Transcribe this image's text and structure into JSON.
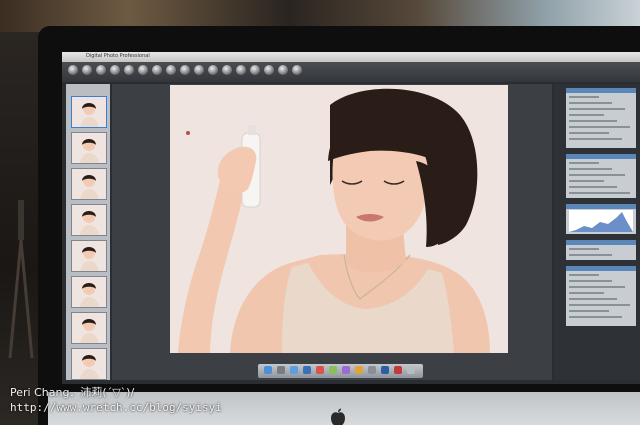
{
  "watermark": {
    "author": "Peri Chang．沛莉(´▽`)/",
    "url": "http://www.wretch.cc/blog/syisyi"
  },
  "app": {
    "title": "Digital Photo Professional"
  },
  "colors": {
    "photo_background": "#efe4df",
    "hair": "#2a1c16",
    "skin": "#f1c9b2",
    "tank_top": "#e9d6c8",
    "interface_dark": "#2a2d31",
    "thumbnail_strip": "#b9bec4",
    "palette_panel": "#c8cdd2"
  },
  "thumbnails": {
    "count": 8,
    "selected_index": 0
  },
  "dock": {
    "icon_names": [
      "finder-icon",
      "dashboard-icon",
      "mail-icon",
      "safari-icon",
      "ical-icon",
      "preview-icon",
      "itunes-icon",
      "iphoto-icon",
      "system-preferences-icon",
      "photoshop-icon",
      "dpp-icon",
      "trash-icon"
    ]
  }
}
